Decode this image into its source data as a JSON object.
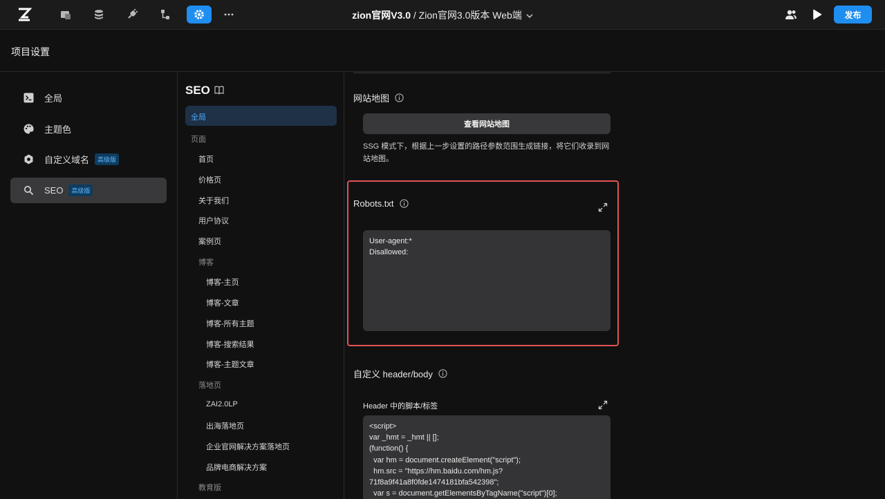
{
  "topbar": {
    "logo": "zion-logo-icon",
    "icons": [
      "pages-icon",
      "database-icon",
      "plugin-icon",
      "workflow-icon",
      "settings-icon",
      "more-icon"
    ],
    "project_name": "zion官网V3.0",
    "separator": " / ",
    "version_name": "Zion官网3.0版本 Web端",
    "publish_label": "发布",
    "accent": "#1f8ef1"
  },
  "header": {
    "title": "项目设置"
  },
  "left_nav": {
    "items": [
      {
        "label": "全局",
        "icon": "terminal-icon",
        "badge": ""
      },
      {
        "label": "主题色",
        "icon": "palette-icon",
        "badge": ""
      },
      {
        "label": "自定义域名",
        "icon": "domain-icon",
        "badge": "高级版"
      },
      {
        "label": "SEO",
        "icon": "search-icon",
        "badge": "高级版"
      }
    ]
  },
  "tree": {
    "title": "SEO",
    "selected": "全局",
    "items": [
      {
        "label": "页面",
        "kind": "group"
      },
      {
        "label": "首页",
        "kind": "page"
      },
      {
        "label": "价格页",
        "kind": "page"
      },
      {
        "label": "关于我们",
        "kind": "page"
      },
      {
        "label": "用户协议",
        "kind": "page"
      },
      {
        "label": "案例页",
        "kind": "page"
      },
      {
        "label": "博客",
        "kind": "subgroup"
      },
      {
        "label": "博客-主页",
        "kind": "subpage"
      },
      {
        "label": "博客-文章",
        "kind": "subpage"
      },
      {
        "label": "博客-所有主题",
        "kind": "subpage"
      },
      {
        "label": "博客-搜索结果",
        "kind": "subpage"
      },
      {
        "label": "博客-主题文章",
        "kind": "subpage"
      },
      {
        "label": "落地页",
        "kind": "subgroup"
      },
      {
        "label": "ZAI2.0LP",
        "kind": "subpage"
      },
      {
        "label": "出海落地页",
        "kind": "subpage"
      },
      {
        "label": "企业官网解决方案落地页",
        "kind": "subpage"
      },
      {
        "label": "品牌电商解决方案",
        "kind": "subpage"
      },
      {
        "label": "教育版",
        "kind": "subgroup"
      }
    ]
  },
  "content": {
    "sitemap": {
      "title": "网站地图",
      "button": "查看网站地图",
      "description": "SSG 模式下，根据上一步设置的路径参数范围生成链接，将它们收录到网站地图。"
    },
    "robots": {
      "title": "Robots.txt",
      "value": "User-agent:*\nDisallowed:",
      "highlight": "#e25454"
    },
    "custom": {
      "title": "自定义 header/body",
      "header_label": "Header 中的脚本/标签",
      "header_value": "<script>\nvar _hmt = _hmt || [];\n(function() {\n  var hm = document.createElement(\"script\");\n  hm.src = \"https://hm.baidu.com/hm.js?\n71f8a9f41a8f0fde1474181bfa542398\";\n  var s = document.getElementsByTagName(\"script\")[0];"
    }
  }
}
